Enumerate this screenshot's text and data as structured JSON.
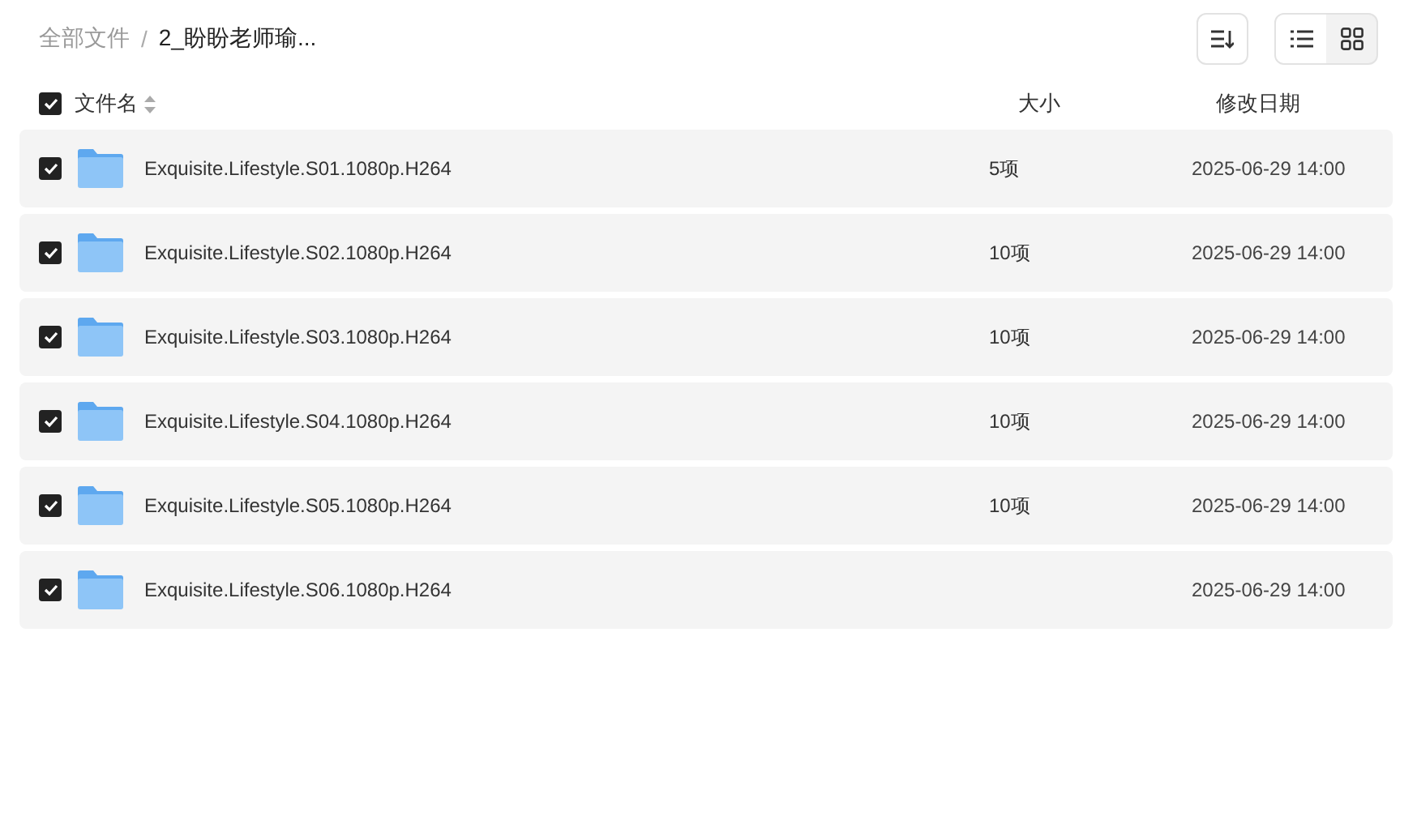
{
  "breadcrumb": [
    {
      "label": "全部文件",
      "current": false
    },
    {
      "label": "2_盼盼老师瑜...",
      "current": true
    }
  ],
  "breadcrumb_separator": "/",
  "view_modes": [
    {
      "kind": "list",
      "selected": true
    },
    {
      "kind": "grid",
      "selected": false
    }
  ],
  "header": {
    "checked": true,
    "name": "文件名",
    "size": "大小",
    "date": "修改日期"
  },
  "rows": [
    {
      "name": "Exquisite.Lifestyle.S01.1080p.H264",
      "size": "5项",
      "date": "2025-06-29 14:00",
      "checked": true
    },
    {
      "name": "Exquisite.Lifestyle.S02.1080p.H264",
      "size": "10项",
      "date": "2025-06-29 14:00",
      "checked": true
    },
    {
      "name": "Exquisite.Lifestyle.S03.1080p.H264",
      "size": "10项",
      "date": "2025-06-29 14:00",
      "checked": true
    },
    {
      "name": "Exquisite.Lifestyle.S04.1080p.H264",
      "size": "10项",
      "date": "2025-06-29 14:00",
      "checked": true
    },
    {
      "name": "Exquisite.Lifestyle.S05.1080p.H264",
      "size": "10项",
      "date": "2025-06-29 14:00",
      "checked": true
    },
    {
      "name": "Exquisite.Lifestyle.S06.1080p.H264",
      "date": "2025-06-29 14:00",
      "checked": true
    }
  ]
}
